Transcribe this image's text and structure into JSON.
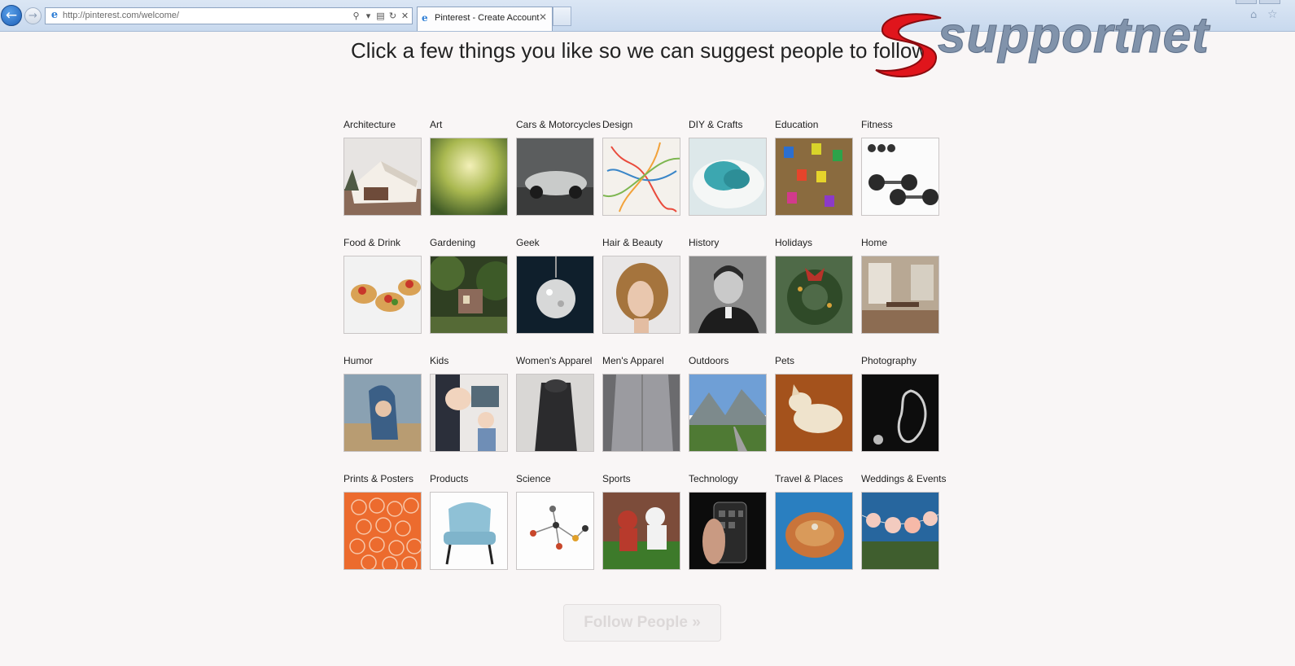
{
  "browser": {
    "url": "http://pinterest.com/welcome/",
    "tab_title": "Pinterest - Create Account"
  },
  "watermark": {
    "text": "supportnet",
    "color": "#8193ab",
    "accent": "#e0151c"
  },
  "page": {
    "heading": "Click a few things you like so we can suggest people to follow.",
    "follow_button": "Follow People »"
  },
  "categories": [
    [
      {
        "label": "Architecture"
      },
      {
        "label": "Art"
      },
      {
        "label": "Cars & Motorcycles"
      },
      {
        "label": "Design"
      },
      {
        "label": "DIY & Crafts"
      },
      {
        "label": "Education"
      },
      {
        "label": "Fitness"
      }
    ],
    [
      {
        "label": "Food & Drink"
      },
      {
        "label": "Gardening"
      },
      {
        "label": "Geek"
      },
      {
        "label": "Hair & Beauty"
      },
      {
        "label": "History"
      },
      {
        "label": "Holidays"
      },
      {
        "label": "Home"
      }
    ],
    [
      {
        "label": "Humor"
      },
      {
        "label": "Kids"
      },
      {
        "label": "Women's Apparel"
      },
      {
        "label": "Men's Apparel"
      },
      {
        "label": "Outdoors"
      },
      {
        "label": "Pets"
      },
      {
        "label": "Photography"
      }
    ],
    [
      {
        "label": "Prints & Posters"
      },
      {
        "label": "Products"
      },
      {
        "label": "Science"
      },
      {
        "label": "Sports"
      },
      {
        "label": "Technology"
      },
      {
        "label": "Travel & Places"
      },
      {
        "label": "Weddings & Events"
      }
    ]
  ]
}
